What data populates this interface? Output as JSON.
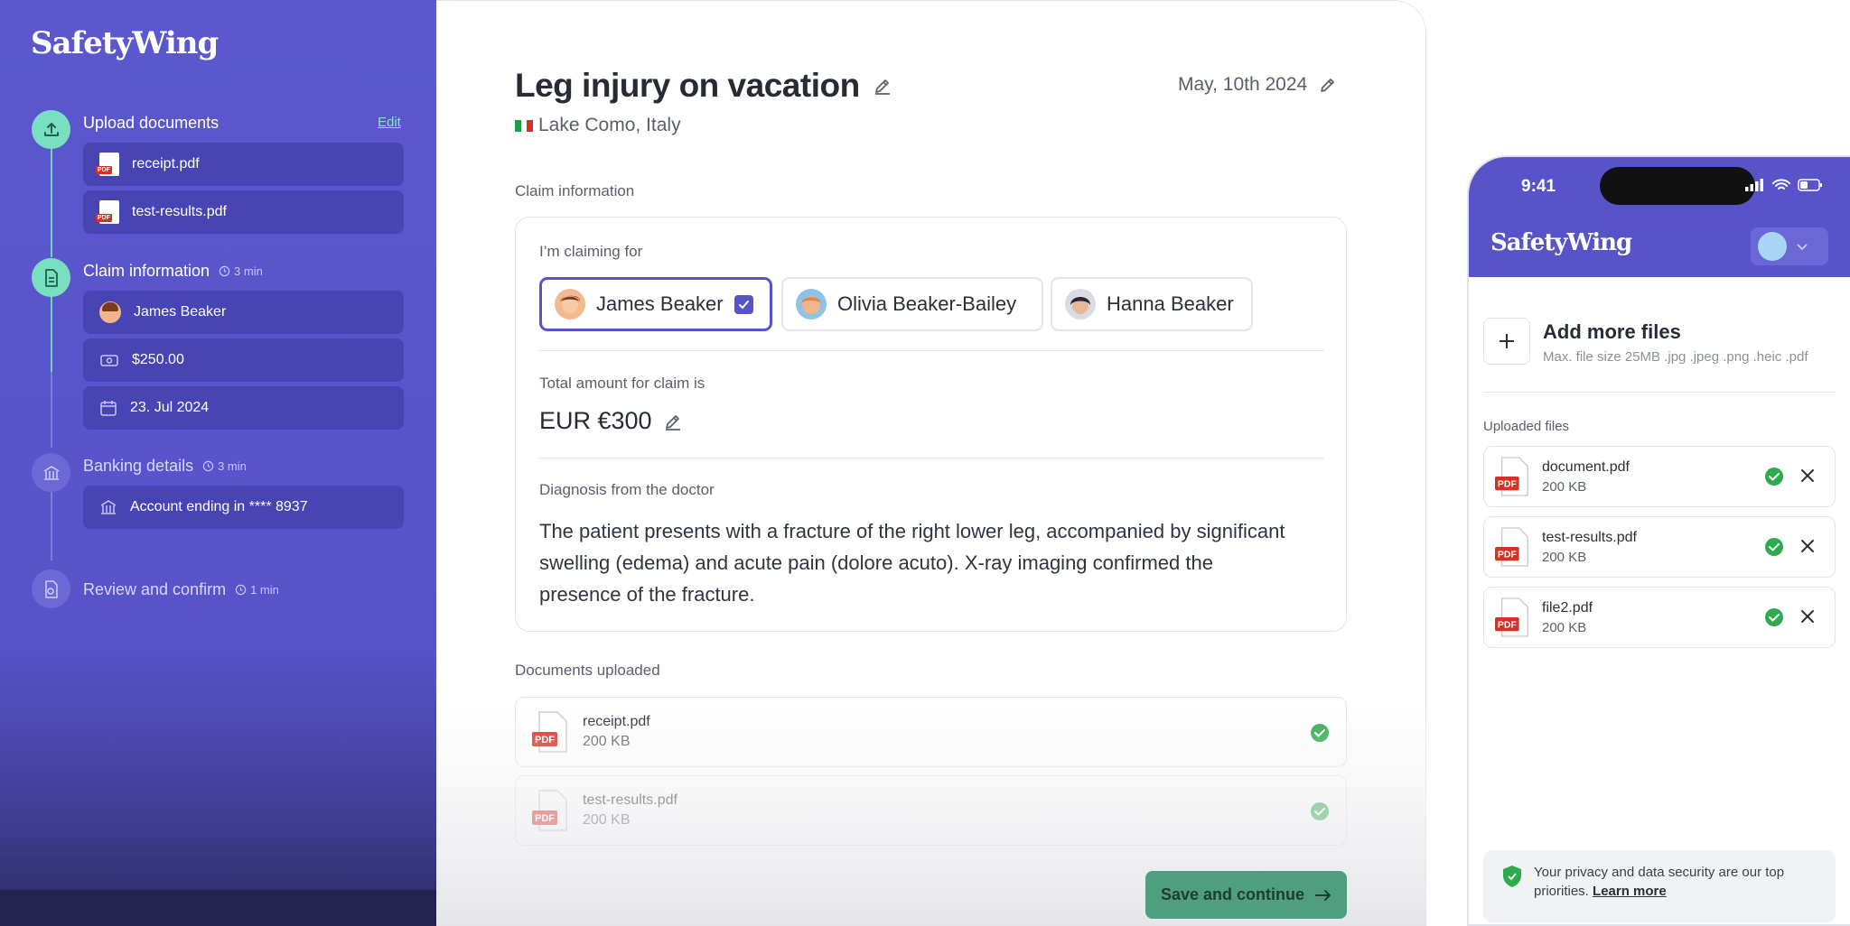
{
  "sidebar": {
    "logo": "SafetyWing",
    "edit_label": "Edit",
    "steps": [
      {
        "title": "Upload documents",
        "time": "",
        "items": [
          "receipt.pdf",
          "test-results.pdf"
        ]
      },
      {
        "title": "Claim information",
        "time": "3 min",
        "items": [
          "James Beaker",
          "$250.00",
          "23. Jul 2024"
        ]
      },
      {
        "title": "Banking details",
        "time": "3 min",
        "items": [
          "Account ending in **** 8937"
        ]
      },
      {
        "title": "Review and confirm",
        "time": "1 min",
        "items": []
      }
    ]
  },
  "claim": {
    "title": "Leg injury on vacation",
    "location": "Lake Como, Italy",
    "date": "May, 10th 2024",
    "section_label": "Claim information",
    "claiming_for_label": "I’m claiming for",
    "people": [
      "James Beaker",
      "Olivia Beaker-Bailey",
      "Hanna Beaker"
    ],
    "selected_person": "James Beaker",
    "amount_label": "Total amount for claim is",
    "amount": "EUR €300",
    "diagnosis_label": "Diagnosis from the doctor",
    "diagnosis": "The patient presents with a fracture of the right lower leg, accompanied by significant swelling (edema) and acute pain (dolore acuto). X-ray imaging confirmed the presence of the fracture.",
    "documents_label": "Documents uploaded",
    "documents": [
      {
        "name": "receipt.pdf",
        "size": "200 KB"
      },
      {
        "name": "test-results.pdf",
        "size": "200 KB"
      }
    ],
    "save_label": "Save and continue"
  },
  "phone": {
    "time": "9:41",
    "logo": "SafetyWing",
    "add_title": "Add more files",
    "add_sub": "Max. file size 25MB .jpg .jpeg .png .heic .pdf",
    "uploaded_label": "Uploaded files",
    "files": [
      {
        "name": "document.pdf",
        "size": "200 KB"
      },
      {
        "name": "test-results.pdf",
        "size": "200 KB"
      },
      {
        "name": "file2.pdf",
        "size": "200 KB"
      }
    ],
    "privacy_text": "Your privacy and data security are our top priorities.",
    "privacy_link": "Learn more"
  },
  "icons": {
    "pdf_badge": "PDF"
  },
  "colors": {
    "brand": "#5753c9",
    "accent_green": "#78e0c1",
    "success": "#2eaa4f",
    "button": "#4f9e7f"
  }
}
